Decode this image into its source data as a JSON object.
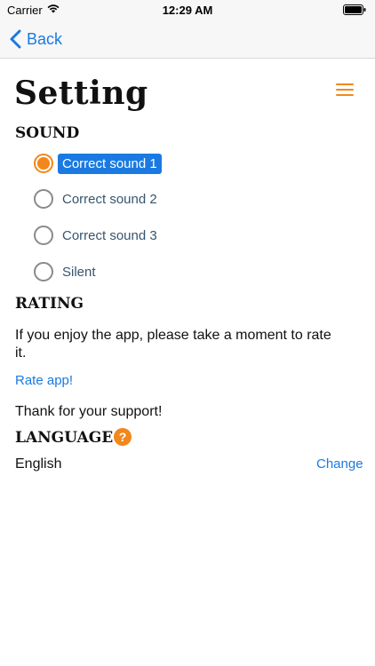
{
  "status_bar": {
    "carrier": "Carrier",
    "time": "12:29 AM"
  },
  "nav": {
    "back_label": "Back"
  },
  "page_title": "Setting",
  "sound": {
    "heading": "SOUND",
    "options": [
      {
        "label": "Correct sound 1",
        "selected": true
      },
      {
        "label": "Correct sound 2",
        "selected": false
      },
      {
        "label": "Correct sound 3",
        "selected": false
      },
      {
        "label": "Silent",
        "selected": false
      }
    ]
  },
  "rating": {
    "heading": "RATING",
    "text": "If you enjoy the app, please take a moment to rate it.",
    "rate_link": "Rate app!",
    "thanks": "Thank for your support!"
  },
  "language": {
    "heading": "LANGUAGE",
    "help_icon": "?",
    "current": "English",
    "change_link": "Change"
  },
  "colors": {
    "accent": "#f2871b",
    "link": "#1a7ae2"
  },
  "icons": [
    "wifi-icon",
    "battery-icon",
    "back-chevron-icon",
    "menu-icon",
    "help-icon"
  ]
}
